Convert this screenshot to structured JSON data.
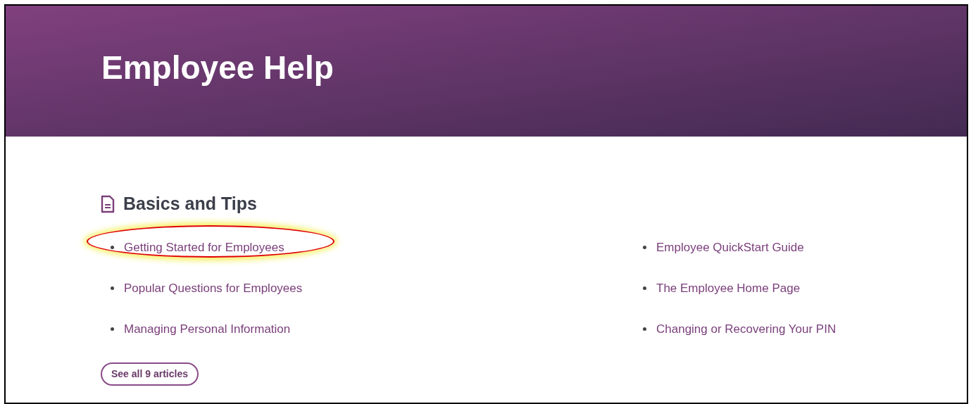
{
  "header": {
    "title": "Employee Help"
  },
  "section": {
    "title": "Basics and Tips",
    "columns": [
      [
        {
          "label": "Getting Started for Employees",
          "circled": true
        },
        {
          "label": "Popular Questions for Employees",
          "circled": false
        },
        {
          "label": "Managing Personal Information",
          "circled": false
        }
      ],
      [
        {
          "label": "Employee QuickStart Guide",
          "circled": false
        },
        {
          "label": "The Employee Home Page",
          "circled": false
        },
        {
          "label": "Changing or Recovering Your PIN",
          "circled": false
        }
      ]
    ],
    "see_all": "See all 9 articles"
  }
}
